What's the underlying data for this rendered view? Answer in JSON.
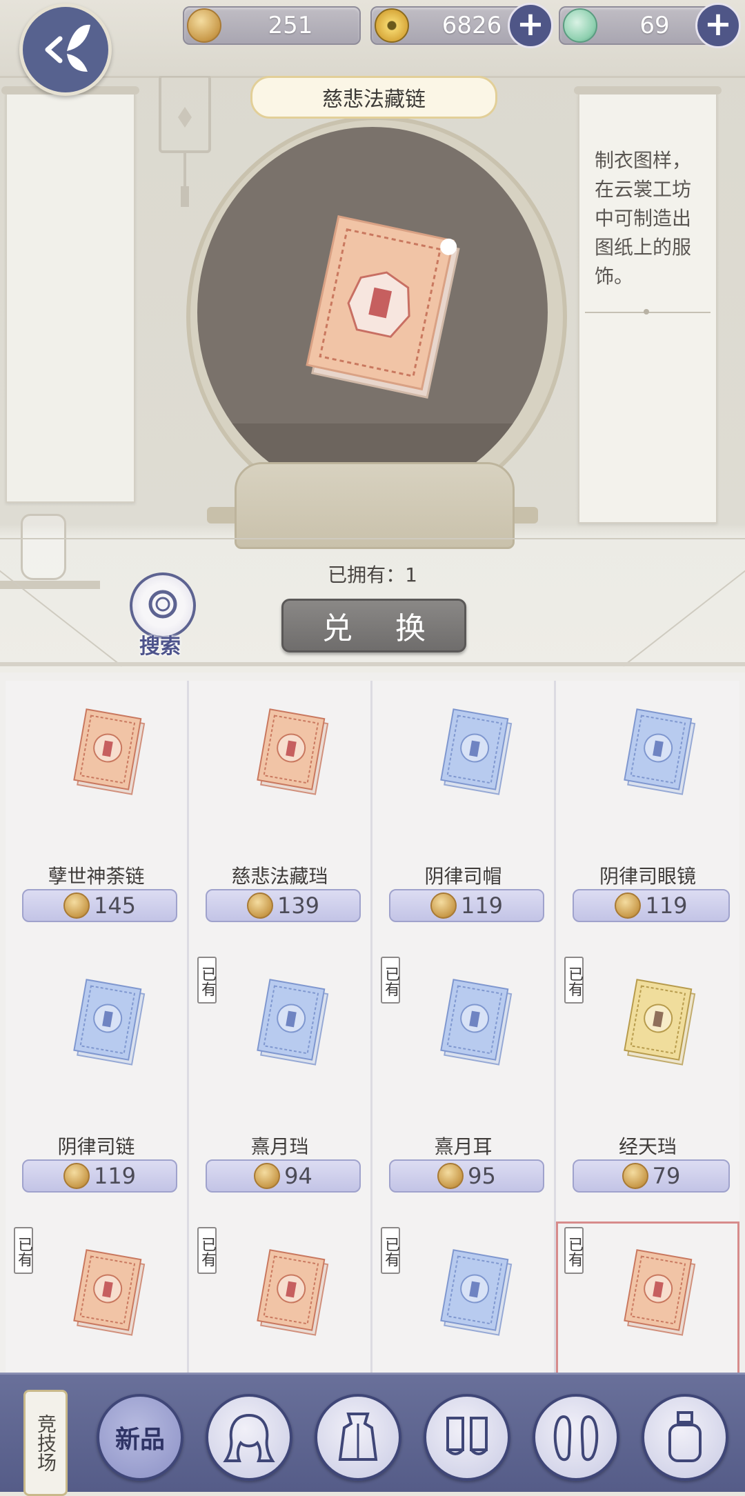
{
  "currencies": [
    {
      "name": "gold-coin",
      "value": "251"
    },
    {
      "name": "copper-coin",
      "value": "6826"
    },
    {
      "name": "jade-dragon",
      "value": "69"
    }
  ],
  "item_title": "慈悲法藏链",
  "item_description": "制衣图样，在云裳工坊中可制造出图纸上的服饰。",
  "owned_label": "已拥有：1",
  "exchange_label": "兑 换",
  "search_label": "搜索",
  "owned_tag": "已有",
  "items": [
    {
      "name": "孽世神荼链",
      "price": "145",
      "color": "orange",
      "owned": false
    },
    {
      "name": "慈悲法藏珰",
      "price": "139",
      "color": "orange",
      "owned": false
    },
    {
      "name": "阴律司帽",
      "price": "119",
      "color": "blue",
      "owned": false
    },
    {
      "name": "阴律司眼镜",
      "price": "119",
      "color": "blue",
      "owned": false
    },
    {
      "name": "阴律司链",
      "price": "119",
      "color": "blue",
      "owned": false
    },
    {
      "name": "熹月珰",
      "price": "94",
      "color": "blue",
      "owned": true
    },
    {
      "name": "熹月耳",
      "price": "95",
      "color": "blue",
      "owned": true
    },
    {
      "name": "经天珰",
      "price": "79",
      "color": "yellow",
      "owned": true
    },
    {
      "name": "",
      "price": "",
      "color": "orange",
      "owned": true
    },
    {
      "name": "",
      "price": "",
      "color": "orange",
      "owned": true
    },
    {
      "name": "",
      "price": "",
      "color": "blue",
      "owned": true
    },
    {
      "name": "",
      "price": "",
      "color": "orange",
      "owned": true,
      "selected": true
    }
  ],
  "bottom_nav": {
    "arena_label": "竞技场",
    "new_label": "新品",
    "icons": [
      "hair-icon",
      "dress-icon",
      "socks-icon",
      "shoes-icon",
      "cosmetics-icon"
    ]
  },
  "colors": {
    "accent": "#4f5687",
    "price_bar": "#c3c4e6",
    "selected_border": "#d78b8b"
  }
}
